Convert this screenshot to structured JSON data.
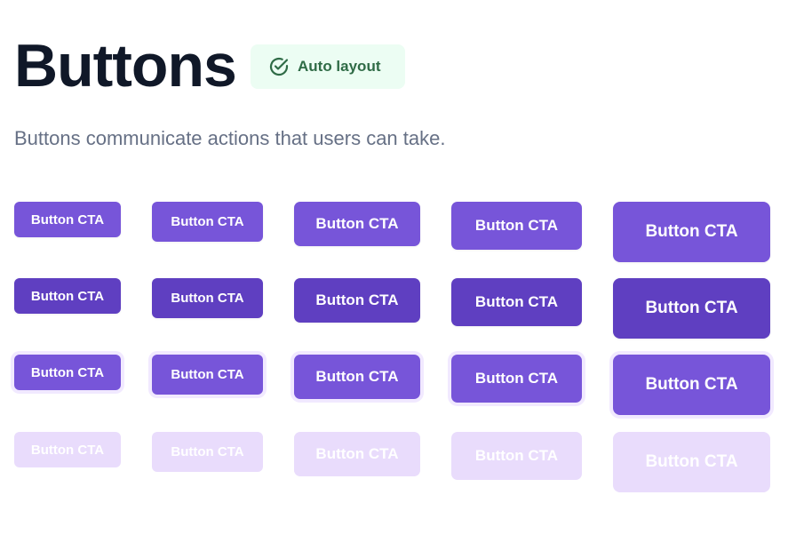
{
  "header": {
    "title": "Buttons",
    "badge": {
      "label": "Auto layout",
      "icon": "check-circle-icon",
      "color": "#2f6b46",
      "background": "#ecfdf3"
    }
  },
  "description": "Buttons communicate actions that users can take.",
  "colors": {
    "default": "#7755d9",
    "hover": "#5f3fc1",
    "focus_ring": "#f1e9ff",
    "disabled": "#e9dcfc"
  },
  "button_grid": {
    "sizes": [
      "sm",
      "md",
      "lg",
      "xl",
      "2xl"
    ],
    "states": [
      "default",
      "hover",
      "focus",
      "disabled"
    ],
    "label": "Button CTA"
  }
}
